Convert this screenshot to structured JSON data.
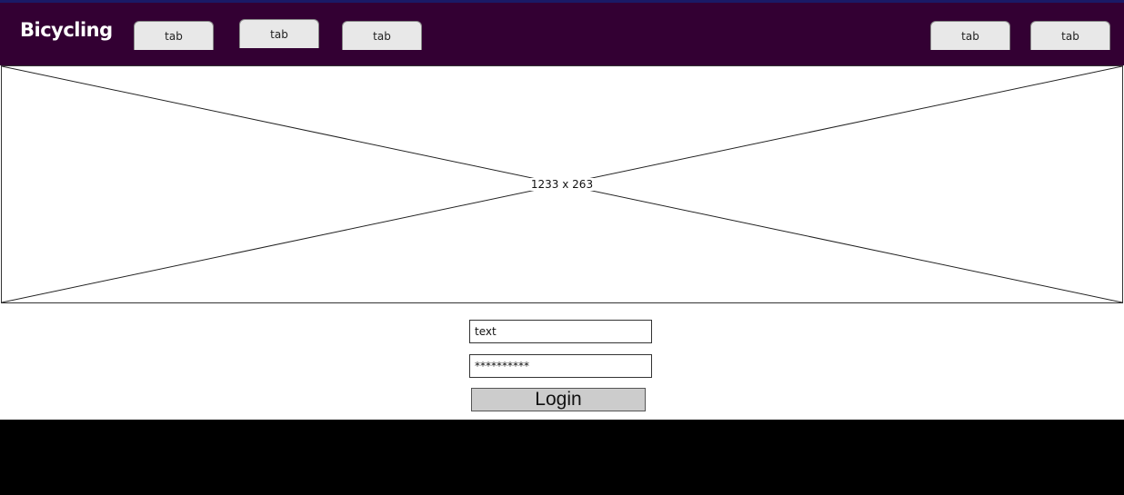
{
  "header": {
    "brand": "Bicycling",
    "tabs": [
      {
        "label": "tab"
      },
      {
        "label": "tab"
      },
      {
        "label": "tab"
      },
      {
        "label": "tab"
      },
      {
        "label": "tab"
      }
    ]
  },
  "hero": {
    "placeholder_label": "1233 x 263"
  },
  "login_form": {
    "username_value": "text",
    "password_value": "**********",
    "login_label": "Login"
  },
  "colors": {
    "navbar": "#330033",
    "footer": "#000000",
    "button": "#cccccc"
  }
}
